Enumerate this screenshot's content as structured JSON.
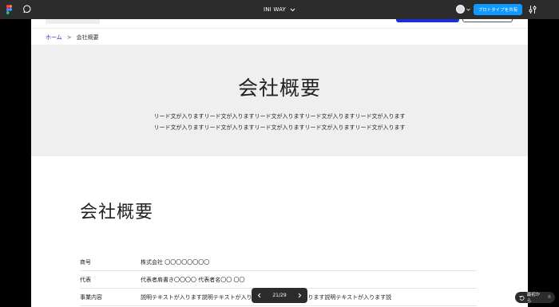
{
  "app": {
    "file_title": "INI WAY",
    "share_label": "プロトタイプを共有",
    "icons": [
      "figma-logo-icon",
      "comment-icon",
      "chevron-down-icon",
      "settings-sliders-icon"
    ]
  },
  "breadcrumb": {
    "home": "ホーム",
    "separator": ">",
    "current": "会社概要"
  },
  "hero": {
    "title": "会社概要",
    "lead_line1": "リード文が入りますリード文が入りますリード文が入りますリード文が入りますリード文が入ります",
    "lead_line2": "リード文が入りますリード文が入りますリード文が入りますリード文が入りますリード文が入ります"
  },
  "section": {
    "title": "会社概要"
  },
  "info_table": [
    {
      "label": "商号",
      "value": "株式会社 〇〇〇〇〇〇〇〇"
    },
    {
      "label": "代表",
      "value": "代表者肩書き〇〇〇〇 代表者名〇〇 〇〇"
    },
    {
      "label": "事業内容",
      "value": "説明テキストが入ります説明テキストが入ります説明テキストが入ります説明テキストが入ります説"
    }
  ],
  "pager": {
    "label": "21/29"
  },
  "restart": {
    "label": "最初から",
    "shortcut": "R"
  },
  "colors": {
    "toolbar_bg": "#2c2c2c",
    "share_blue": "#0d99ff",
    "accent_blue": "#1a2fd6",
    "hero_bg": "#efefef"
  }
}
